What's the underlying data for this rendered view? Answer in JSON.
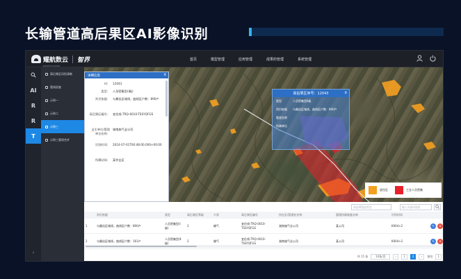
{
  "slide": {
    "title": "长输管道高后果区AI影像识别"
  },
  "topbar": {
    "logo_text": "耀航数云",
    "logo_sub": "ARSEICLOUD",
    "brand": "智界",
    "nav": [
      "首页",
      "模型管理",
      "应用管理",
      "成果的管理",
      "系统管理"
    ],
    "icons": [
      "user-icon",
      "power-icon"
    ]
  },
  "rail": {
    "items": [
      "Q",
      "AI",
      "R",
      "R",
      "T"
    ],
    "bottom": "›"
  },
  "menu": {
    "items": [
      "高后果区风险清晰",
      "管线巡查",
      "示例一",
      "示例二",
      "示例三",
      "示例三管线合并"
    ],
    "active_index": 4
  },
  "detail": {
    "title": "详细信息",
    "close": "x",
    "rows": [
      {
        "k": "Id：",
        "v": "12043"
      },
      {
        "k": "类型：",
        "v": "人员密集型(Ⅰ级)"
      },
      {
        "k": "判识依据：",
        "v": "与最佳区域线，曲线区户数：890户"
      },
      {
        "k": "高后果区编号：",
        "v": "宜伦线-TRQ-0010-TSSYQFGS"
      },
      {
        "k": "业主单位/管理单位名称：",
        "v": "湖南施气业公司"
      },
      {
        "k": "识别时间：",
        "v": "2014-07-01T00:48:00.000+00:00"
      },
      {
        "k": "所属站场：",
        "v": "某作业区"
      }
    ]
  },
  "map_popup": {
    "title": "高后果区序号：12043",
    "close": "x",
    "rows": [
      {
        "k": "类型",
        "v": "人员密集型II级"
      },
      {
        "k": "判识依据",
        "v": "与最佳区域线，曲线区户数：890户"
      },
      {
        "k": "管道名称",
        "v": ""
      },
      {
        "k": "所属单位",
        "v": ""
      }
    ]
  },
  "legend": {
    "items": [
      {
        "label": "居住区",
        "color": "#f5a020"
      },
      {
        "label": "工业人员密集",
        "color": "#e8202a"
      }
    ]
  },
  "table": {
    "select_placeholder": "请选择管道类型",
    "input_placeholder": "输入关键词搜索",
    "search_icon": "search-icon",
    "headers": [
      "",
      "判识依据",
      "类型",
      "高后果区等级",
      "介质",
      "高后果区编号",
      "所在区/管理处名称",
      "管理所属装备名称",
      "识别时间",
      ""
    ],
    "rows": [
      {
        "idx": "1",
        "basis": "与最佳区域线，曲线区户数：890户",
        "type": "人员密集型(Ⅰ级)",
        "level": "3",
        "medium": "输气",
        "code": "宜伦线-TRQ-0010-TSSYQFGS",
        "unit": "湖南施气业公司",
        "mgr": "某公司",
        "time": "K004+2"
      },
      {
        "idx": "2",
        "basis": "与最佳区域线，曲线区户数：161户",
        "type": "人员密集型(Ⅱ级)",
        "level": "2",
        "medium": "输气",
        "code": "宜伦线-TRQ-0010-TSSYQFGS",
        "unit": "湖南施气业公司",
        "mgr": "某公司",
        "time": "K004+2"
      }
    ],
    "pager": {
      "total": "共 15 条",
      "size": "10条/页",
      "prev": "‹",
      "pages": [
        "1",
        "2"
      ],
      "current": "2",
      "next": "›",
      "goto_label": "前往",
      "goto_value": "1"
    }
  }
}
